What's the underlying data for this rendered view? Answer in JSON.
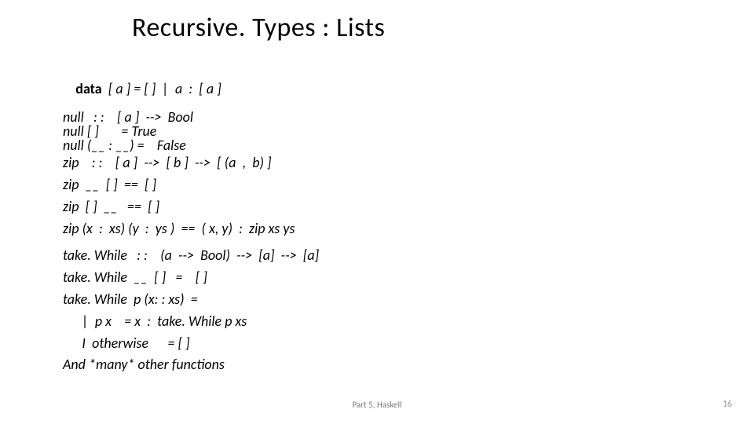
{
  "title": "Recursive. Types : Lists",
  "code1": {
    "l1a": "data",
    "l1b": "  [ a ] = [ ]  |  a  :  [ a ]",
    "l2": "null   : :    [ a ]  -->  Bool",
    "l3": "null [ ]       = True",
    "l4": "null (__ : __) =    False",
    "l5": "zip    : :    [ a ]  -->  [ b ]  -->  [ (a  ,  b) ]",
    "l6": "zip  __  [ ]  ==  [ ]",
    "l7": "zip  [ ]  __   ==  [ ]",
    "l8": "zip (x  :  xs) (y  :  ys )  ==  ( x, y)  :  zip xs ys"
  },
  "code2": {
    "l1": "take. While   : :    (a  -->  Bool)  -->  [a]  -->  [a]",
    "l2": "take. While  __  [ ]   =    [ ]",
    "l3": "take. While  p (x: : xs)  =",
    "l4": "      |  p x    = x  :  take. While p xs",
    "l5": "      I  otherwise      = [ ]",
    "l6": "And *many* other functions"
  },
  "footer": {
    "center": "Part 5, Haskell",
    "page": "16"
  }
}
